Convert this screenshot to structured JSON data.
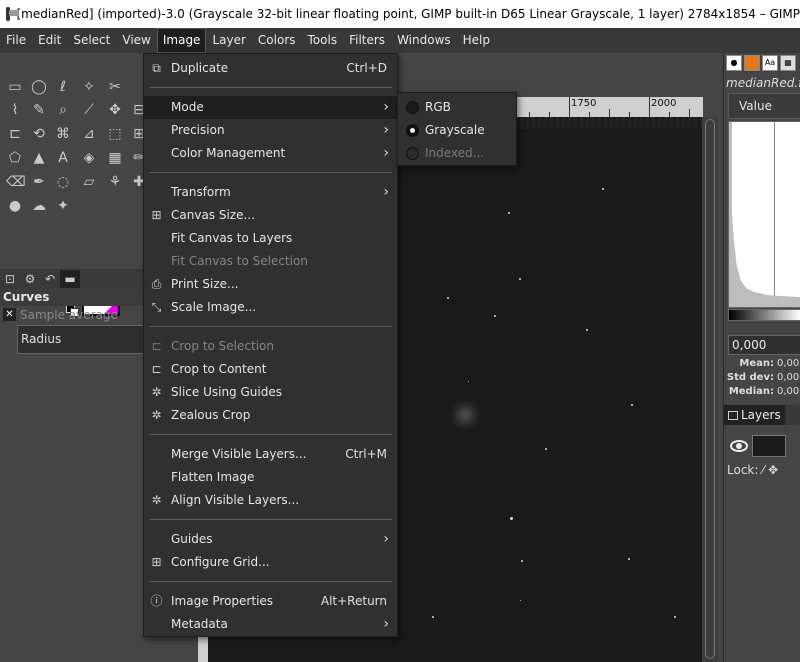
{
  "window": {
    "title": "[medianRed] (imported)-3.0 (Grayscale 32-bit linear floating point, GIMP built-in D65 Linear Grayscale, 1 layer) 2784x1854 – GIMP"
  },
  "menubar": {
    "items": [
      "File",
      "Edit",
      "Select",
      "View",
      "Image",
      "Layer",
      "Colors",
      "Tools",
      "Filters",
      "Windows",
      "Help"
    ],
    "active": "Image"
  },
  "image_menu": {
    "duplicate": {
      "label": "Duplicate",
      "shortcut": "Ctrl+D"
    },
    "mode": {
      "label": "Mode"
    },
    "precision": {
      "label": "Precision"
    },
    "color_management": {
      "label": "Color Management"
    },
    "transform": {
      "label": "Transform"
    },
    "canvas_size": {
      "label": "Canvas Size..."
    },
    "fit_canvas_layers": {
      "label": "Fit Canvas to Layers"
    },
    "fit_canvas_selection": {
      "label": "Fit Canvas to Selection"
    },
    "print_size": {
      "label": "Print Size..."
    },
    "scale_image": {
      "label": "Scale Image..."
    },
    "crop_selection": {
      "label": "Crop to Selection"
    },
    "crop_content": {
      "label": "Crop to Content"
    },
    "slice_guides": {
      "label": "Slice Using Guides"
    },
    "zealous_crop": {
      "label": "Zealous Crop"
    },
    "merge_visible": {
      "label": "Merge Visible Layers...",
      "shortcut": "Ctrl+M"
    },
    "flatten": {
      "label": "Flatten Image"
    },
    "align_visible": {
      "label": "Align Visible Layers..."
    },
    "guides": {
      "label": "Guides"
    },
    "configure_grid": {
      "label": "Configure Grid..."
    },
    "image_properties": {
      "label": "Image Properties",
      "shortcut": "Alt+Return"
    },
    "metadata": {
      "label": "Metadata"
    }
  },
  "mode_submenu": {
    "rgb": {
      "label": "RGB",
      "selected": false
    },
    "grayscale": {
      "label": "Grayscale",
      "selected": true
    },
    "indexed": {
      "label": "Indexed...",
      "selected": false
    }
  },
  "toolbox": {
    "tab_title": "Curves",
    "sample_average_label": "Sample average",
    "radius_label": "Radius",
    "fg_color": "#ffffff",
    "accent_color": "#e000e0"
  },
  "ruler": {
    "labels": [
      "1750",
      "2000"
    ]
  },
  "right_dock": {
    "filename": "medianRed.fi",
    "channel_value": "Value",
    "spin_value": "0,000",
    "stats": [
      {
        "key": "Mean:",
        "value": "0,00"
      },
      {
        "key": "Std dev:",
        "value": "0,00"
      },
      {
        "key": "Median:",
        "value": "0,00"
      }
    ],
    "layers_tab": "Layers",
    "lock_label": "Lock:"
  }
}
